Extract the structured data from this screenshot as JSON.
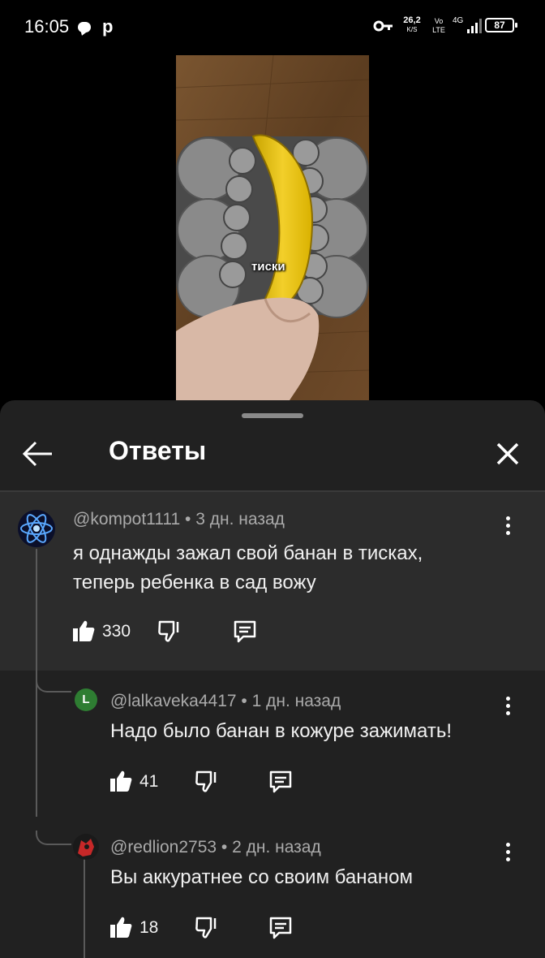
{
  "status_bar": {
    "time": "16:05",
    "app_letter": "p",
    "net_speed_value": "26,2",
    "net_speed_unit": "K/S",
    "volte_top": "Vo",
    "volte_bottom": "LTE",
    "network": "4G",
    "battery": "87",
    "icons": [
      "chat-bubble-icon",
      "key-icon",
      "signal-icon",
      "battery-icon"
    ]
  },
  "video": {
    "caption": "тиски"
  },
  "sheet": {
    "title": "Ответы",
    "back_icon": "arrow-left-icon",
    "close_icon": "close-icon"
  },
  "comments": [
    {
      "author": "@kompot1111",
      "time": "3 дн. назад",
      "meta": "@kompot1111 • 3 дн. назад",
      "text_line1": "я однажды зажал свой банан в тисках,",
      "text_line2": "теперь ребенка в сад вожу",
      "likes": "330"
    },
    {
      "author": "@lalkaveka4417",
      "time": "1 дн. назад",
      "meta": "@lalkaveka4417 • 1 дн. назад",
      "avatar_letter": "L",
      "text_line1": "Надо было банан в кожуре зажимать!",
      "likes": "41"
    },
    {
      "author": "@redlion2753",
      "time": "2 дн. назад",
      "meta": "@redlion2753 • 2 дн. назад",
      "text_line1": "Вы аккуратнее со своим бананом",
      "likes": "18"
    }
  ],
  "colors": {
    "background": "#000000",
    "sheet": "#212121",
    "parent_highlight": "#2c2c2c",
    "meta_text": "#aaaaaa",
    "avatar_green": "#2e7d32"
  }
}
